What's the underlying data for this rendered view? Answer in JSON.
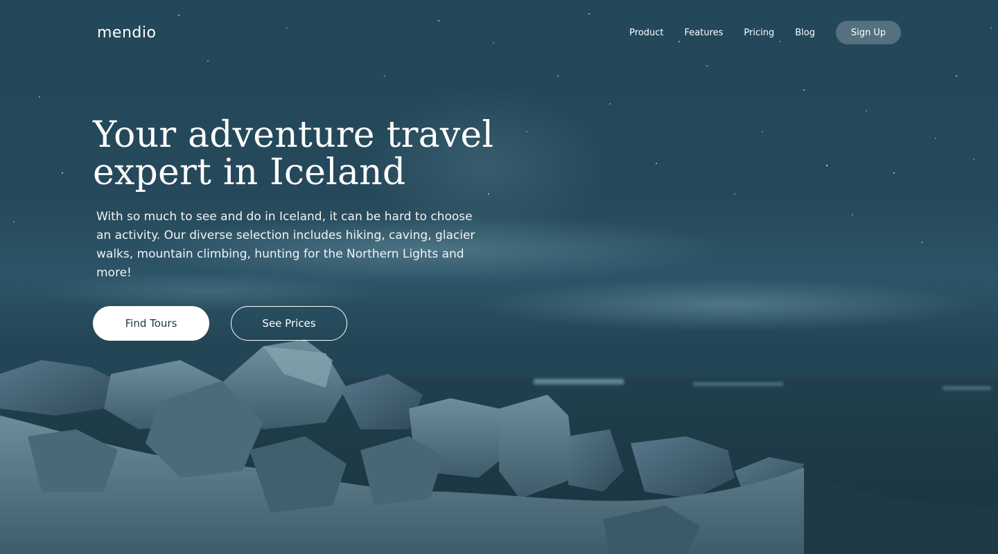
{
  "nav": {
    "logo": "mendio",
    "links": [
      {
        "label": "Product"
      },
      {
        "label": "Features"
      },
      {
        "label": "Pricing"
      },
      {
        "label": "Blog"
      }
    ],
    "signup_label": "Sign Up"
  },
  "hero": {
    "headline_line1": "Your adventure travel",
    "headline_line2": "expert in Iceland",
    "subtext": "With so much to see and do in Iceland, it can be hard to choose an activity. Our diverse selection includes hiking, caving, glacier walks, mountain climbing, hunting for the Northern Lights and more!",
    "primary_cta": "Find Tours",
    "secondary_cta": "See Prices"
  },
  "colors": {
    "background_tint": "#25495a",
    "signup_button": "#55707e",
    "primary_button_bg": "#ffffff",
    "primary_button_text": "#1f3540"
  }
}
